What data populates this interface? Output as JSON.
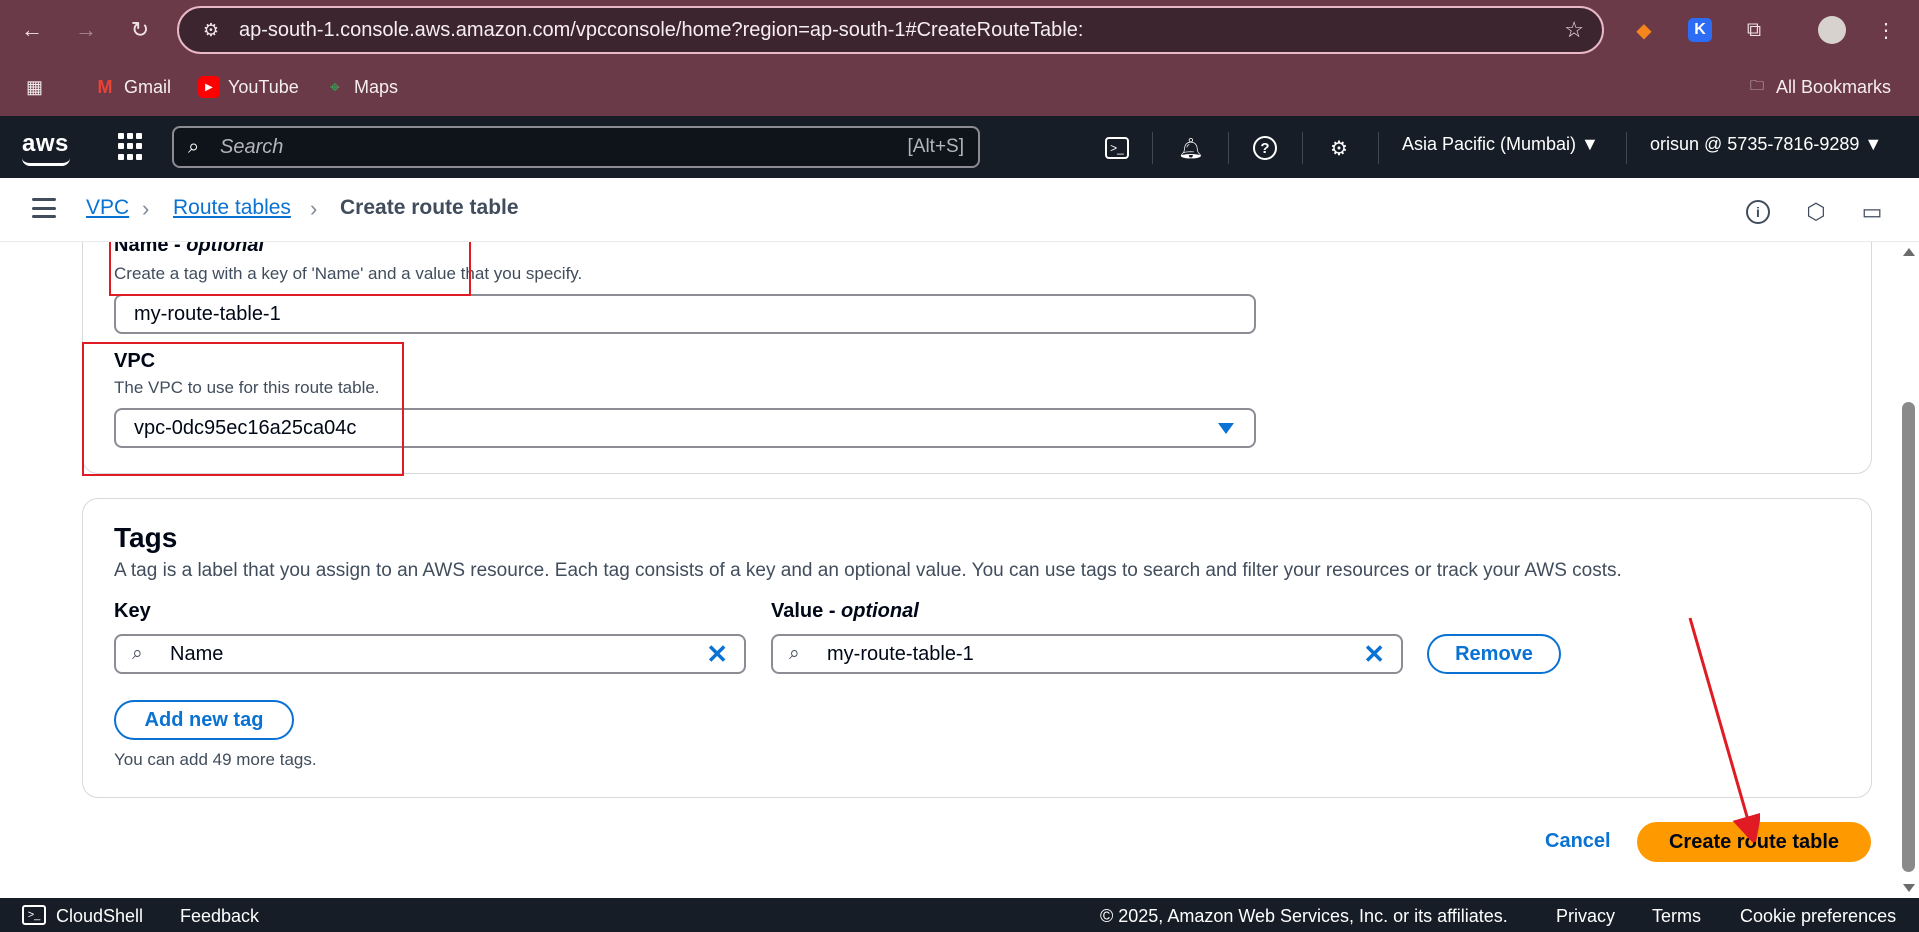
{
  "browser": {
    "url": "ap-south-1.console.aws.amazon.com/vpcconsole/home?region=ap-south-1#CreateRouteTable:",
    "bookmarks": [
      {
        "label": "Gmail",
        "icon": "gmail-icon"
      },
      {
        "label": "YouTube",
        "icon": "youtube-icon"
      },
      {
        "label": "Maps",
        "icon": "maps-icon"
      }
    ],
    "all_bookmarks": "All Bookmarks"
  },
  "aws": {
    "logo": "aws",
    "search_placeholder": "Search",
    "search_shortcut": "[Alt+S]",
    "region": "Asia Pacific (Mumbai) ▼",
    "account": "orisun @ 5735-7816-9289 ▼"
  },
  "breadcrumb": {
    "items": [
      "VPC",
      "Route tables",
      "Create route table"
    ]
  },
  "route_table_settings": {
    "name_label": "Name - ",
    "name_optional": "optional",
    "name_desc": "Create a tag with a key of 'Name' and a value that you specify.",
    "name_value": "my-route-table-1",
    "vpc_label": "VPC",
    "vpc_desc": "The VPC to use for this route table.",
    "vpc_value": "vpc-0dc95ec16a25ca04c"
  },
  "tags": {
    "title": "Tags",
    "desc": "A tag is a label that you assign to an AWS resource. Each tag consists of a key and an optional value. You can use tags to search and filter your resources or track your AWS costs.",
    "key_label": "Key",
    "value_label": "Value - ",
    "value_optional": "optional",
    "rows": [
      {
        "key": "Name",
        "value": "my-route-table-1"
      }
    ],
    "remove_label": "Remove",
    "add_label": "Add new tag",
    "hint": "You can add 49 more tags."
  },
  "actions": {
    "cancel": "Cancel",
    "create": "Create route table"
  },
  "footer": {
    "cloudshell": "CloudShell",
    "feedback": "Feedback",
    "copyright": "© 2025, Amazon Web Services, Inc. or its affiliates.",
    "privacy": "Privacy",
    "terms": "Terms",
    "cookies": "Cookie preferences"
  },
  "colors": {
    "accent": "#0972d3",
    "primary_button": "#ff9900",
    "annotation": "#e01b24"
  }
}
